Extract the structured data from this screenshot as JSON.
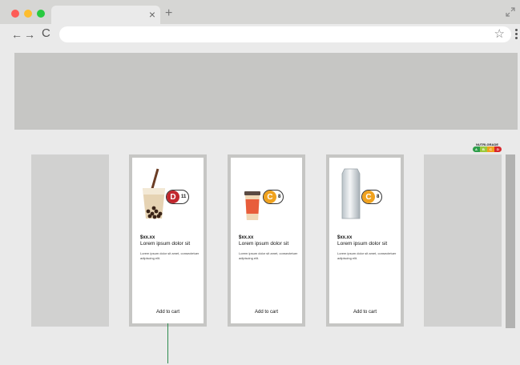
{
  "window": {
    "tab_close": "×",
    "new_tab": "+",
    "back": "←",
    "forward": "→",
    "reload": "C",
    "star": "☆"
  },
  "nutri_legend": {
    "title": "NUTRI-GRADE",
    "grades": [
      "A",
      "B",
      "C",
      "D"
    ],
    "colors": [
      "#2e9e4a",
      "#9bc93b",
      "#f0a21e",
      "#d7262b"
    ]
  },
  "products": [
    {
      "image": "bubble-tea",
      "grade": "D",
      "grade_color": "#c1272d",
      "grade_value": "11",
      "price": "$xx.xx",
      "name": "Lorem ipsum dolor sit",
      "desc": "Lorem ipsum dolor sit amet, consectetuer adipiscing elit.",
      "cta": "Add to cart"
    },
    {
      "image": "coffee-cup",
      "grade": "C",
      "grade_color": "#f0a21e",
      "grade_value": "8",
      "price": "$xx.xx",
      "name": "Lorem ipsum dolor sit",
      "desc": "Lorem ipsum dolor sit amet, consectetuer adipiscing elit.",
      "cta": "Add to cart"
    },
    {
      "image": "soda-can",
      "grade": "C",
      "grade_color": "#f0a21e",
      "grade_value": "8",
      "price": "$xx.xx",
      "name": "Lorem ipsum dolor sit",
      "desc": "Lorem ipsum dolor sit amet, consectetuer adipiscing elit.",
      "cta": "Add to cart"
    }
  ]
}
